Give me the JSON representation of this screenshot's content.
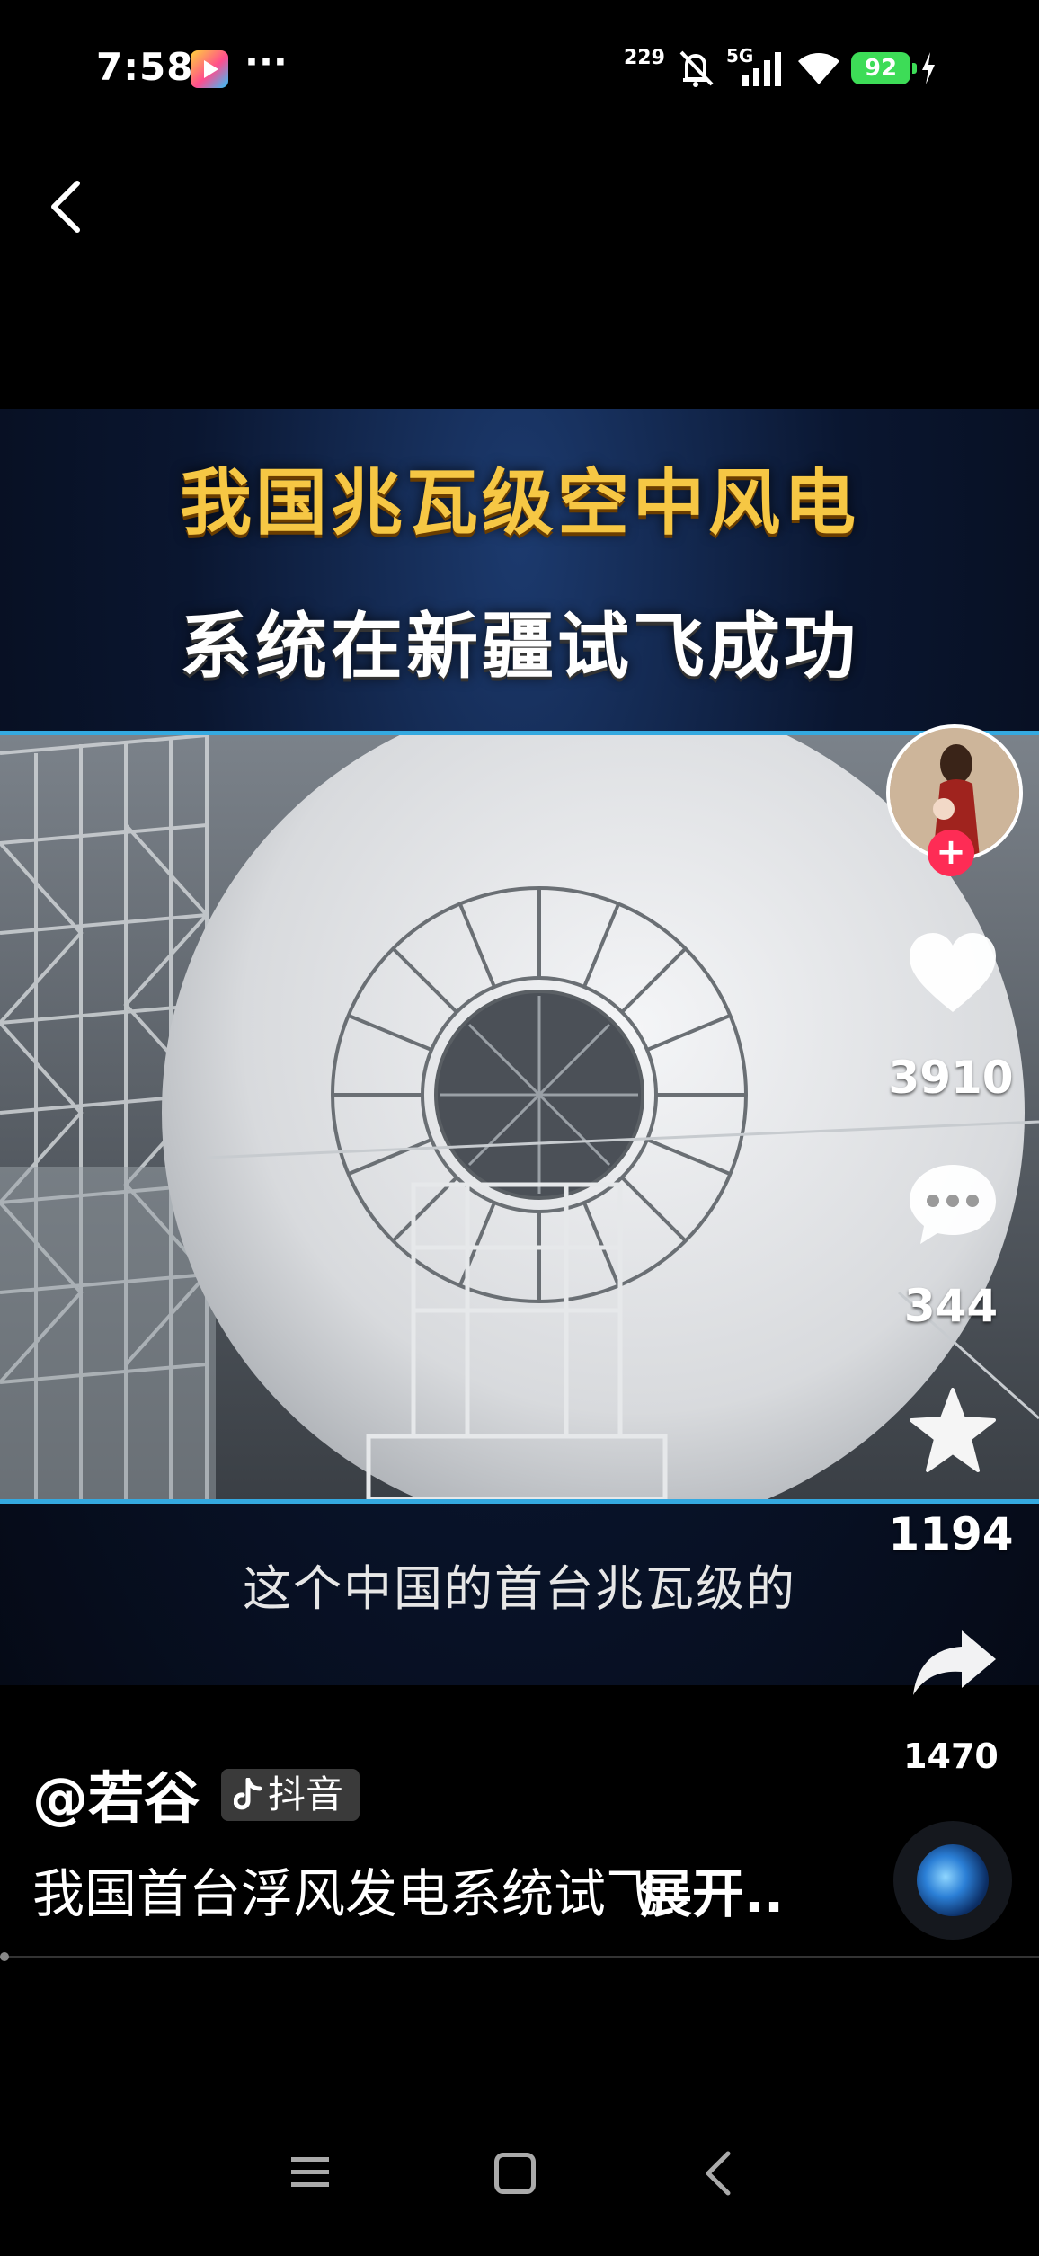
{
  "status_bar": {
    "time": "7:58",
    "more": "···",
    "net_speed": "229",
    "signal_label": "5G",
    "battery": "92",
    "icons": [
      "video-app-notification-icon",
      "mute-icon",
      "signal-icon",
      "wifi-icon",
      "battery-icon",
      "charging-icon"
    ]
  },
  "video": {
    "title_line1": "我国兆瓦级空中风电",
    "title_line2": "系统在新疆试飞成功",
    "subtitle": "这个中国的首台兆瓦级的"
  },
  "sidebar": {
    "likes": "3910",
    "comments": "344",
    "favorites": "1194",
    "shares": "1470",
    "follow_symbol": "+"
  },
  "post": {
    "author": "@若谷",
    "platform": "抖音",
    "caption": "我国首台浮风发电系统试飞",
    "caption_more": "展开..",
    "progress": 0.0
  },
  "colors": {
    "accent_red": "#fe2c55",
    "title_gold": "#f6c744",
    "frame_blue": "#34a9e0",
    "battery_green": "#3ddc57"
  }
}
